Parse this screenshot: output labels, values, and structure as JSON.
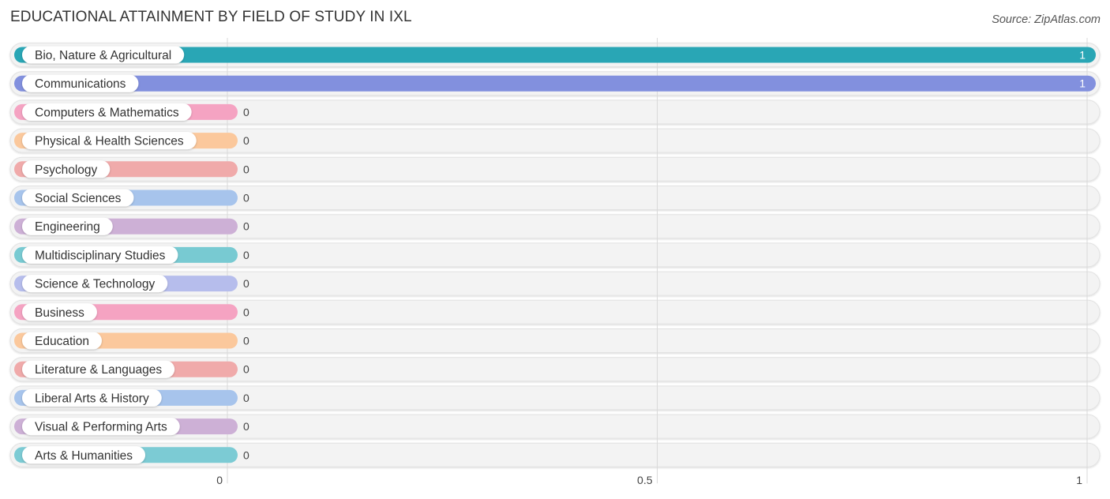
{
  "header": {
    "title": "EDUCATIONAL ATTAINMENT BY FIELD OF STUDY IN IXL",
    "source": "Source: ZipAtlas.com"
  },
  "chart_data": {
    "type": "bar",
    "orientation": "horizontal",
    "title": "EDUCATIONAL ATTAINMENT BY FIELD OF STUDY IN IXL",
    "xlabel": "",
    "ylabel": "",
    "xlim": [
      0,
      1
    ],
    "xticks": [
      0,
      0.5,
      1
    ],
    "xtick_labels": [
      "0",
      "0.5",
      "1"
    ],
    "grid": true,
    "categories": [
      "Bio, Nature & Agricultural",
      "Communications",
      "Computers & Mathematics",
      "Physical & Health Sciences",
      "Psychology",
      "Social Sciences",
      "Engineering",
      "Multidisciplinary Studies",
      "Science & Technology",
      "Business",
      "Education",
      "Literature & Languages",
      "Liberal Arts & History",
      "Visual & Performing Arts",
      "Arts & Humanities"
    ],
    "values": [
      1,
      1,
      0,
      0,
      0,
      0,
      0,
      0,
      0,
      0,
      0,
      0,
      0,
      0,
      0
    ],
    "value_labels": [
      "1",
      "1",
      "0",
      "0",
      "0",
      "0",
      "0",
      "0",
      "0",
      "0",
      "0",
      "0",
      "0",
      "0",
      "0"
    ],
    "colors": [
      "#29a6b5",
      "#8290de",
      "#f5a3c2",
      "#fbc89c",
      "#f0aaaa",
      "#a7c4ec",
      "#cdb0d6",
      "#78cad2",
      "#b6bdec",
      "#f5a3c2",
      "#fbc89c",
      "#f0aaaa",
      "#a7c4ec",
      "#cdb0d6",
      "#7ccbd4"
    ]
  }
}
